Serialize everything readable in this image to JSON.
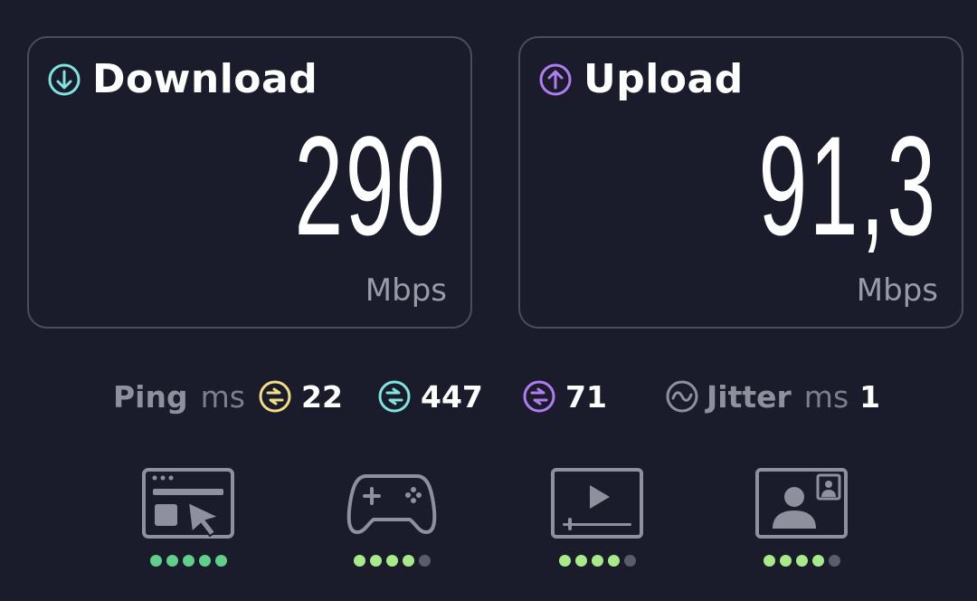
{
  "download": {
    "title": "Download",
    "value": "290",
    "unit": "Mbps",
    "icon": "arrow-down-circle-icon",
    "accent": "#7fe3df"
  },
  "upload": {
    "title": "Upload",
    "value": "91,3",
    "unit": "Mbps",
    "icon": "arrow-up-circle-icon",
    "accent": "#b17cf0"
  },
  "stats": {
    "ping_label": "Ping",
    "ping_unit": "ms",
    "ping_idle": "22",
    "ping_idle_color": "#f2dc84",
    "ping_download": "447",
    "ping_download_color": "#7fe3df",
    "ping_upload": "71",
    "ping_upload_color": "#b17cf0",
    "jitter_label": "Jitter",
    "jitter_unit": "ms",
    "jitter_value": "1"
  },
  "activities": [
    {
      "icon": "web-browsing-icon",
      "rating": 5,
      "max": 5
    },
    {
      "icon": "gaming-controller-icon",
      "rating": 4,
      "max": 5
    },
    {
      "icon": "video-streaming-icon",
      "rating": 4,
      "max": 5
    },
    {
      "icon": "video-call-icon",
      "rating": 4,
      "max": 5
    }
  ],
  "colors": {
    "dot_full": "#5fcf8a",
    "dot_good": "#a6ea8a",
    "dot_off": "#5b5c6a"
  }
}
